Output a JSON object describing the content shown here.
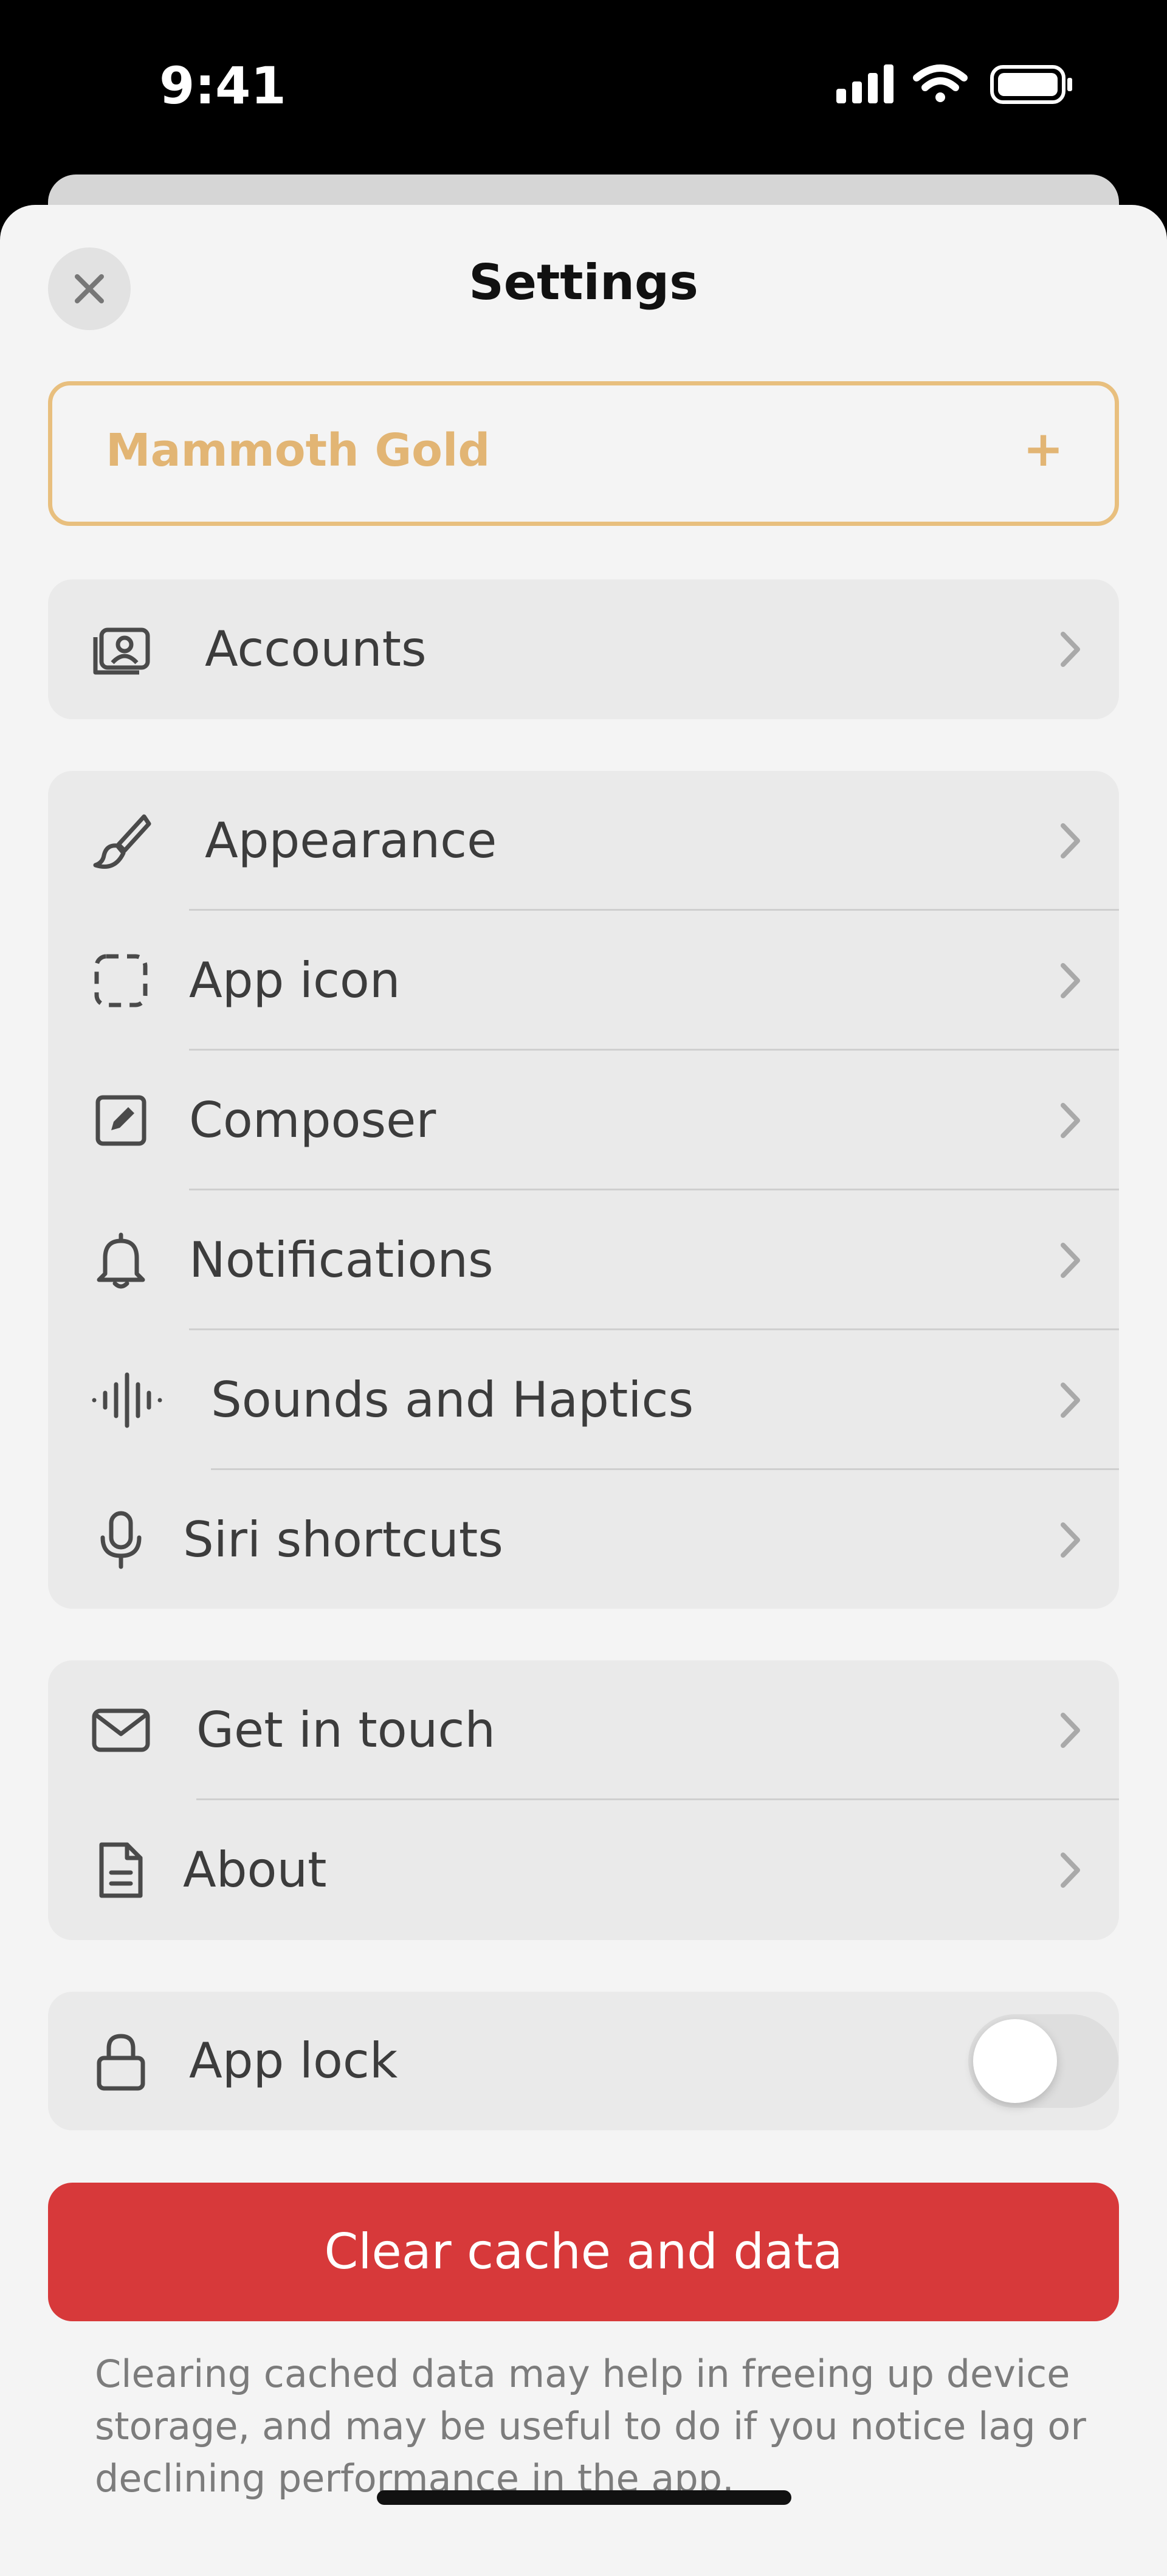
{
  "status_bar": {
    "time": "9:41",
    "icons": [
      "cellular-signal-icon",
      "wifi-icon",
      "battery-icon"
    ]
  },
  "header": {
    "title": "Settings",
    "close_icon": "close-icon"
  },
  "gold": {
    "label": "Mammoth Gold",
    "action": "+"
  },
  "groups": {
    "accounts": [
      {
        "label": "Accounts",
        "icon": "accounts-icon"
      }
    ],
    "general": [
      {
        "label": "Appearance",
        "icon": "paintbrush-icon"
      },
      {
        "label": "App icon",
        "icon": "app-icon-icon"
      },
      {
        "label": "Composer",
        "icon": "compose-icon"
      },
      {
        "label": "Notifications",
        "icon": "bell-icon"
      },
      {
        "label": "Sounds and Haptics",
        "icon": "waveform-icon"
      },
      {
        "label": "Siri shortcuts",
        "icon": "microphone-icon"
      }
    ],
    "support": [
      {
        "label": "Get in touch",
        "icon": "envelope-icon"
      },
      {
        "label": "About",
        "icon": "document-icon"
      }
    ],
    "security": [
      {
        "label": "App lock",
        "icon": "lock-icon",
        "toggle_on": false
      }
    ]
  },
  "clear_cache": {
    "button_label": "Clear cache and data",
    "note": "Clearing cached data may help in freeing up device storage, and may be useful to do if you notice lag or declining performance in the app."
  },
  "colors": {
    "gold_accent": "#e2b574",
    "danger": "#d7393a",
    "sheet_bg": "#f4f4f4",
    "group_bg": "#eaeaea"
  }
}
